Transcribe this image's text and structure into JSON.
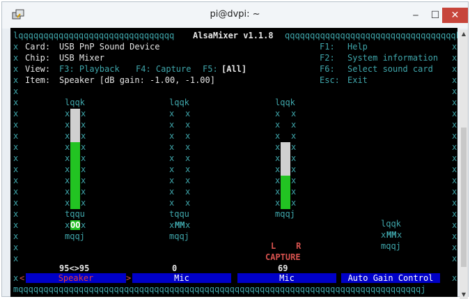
{
  "window": {
    "title": "pi@dvpi: ~",
    "min_glyph": "‒",
    "max_glyph": "☐",
    "close_glyph": "✕"
  },
  "header": {
    "top_border_left": "lqqqqqqqqqqqqqqqqqqqqqqqqqqqqqqq",
    "app_title": "AlsaMixer v1.1.8",
    "top_border_right": "qqqqqqqqqqqqqqqqqqqqqqqqqqqqqqqqqqk",
    "card_label": "Card:",
    "card_value": "USB PnP Sound Device",
    "chip_label": "Chip:",
    "chip_value": "USB Mixer",
    "view_label": "View:",
    "view_f3": "F3: Playback",
    "view_f4": "F4: Capture",
    "view_f5": "F5:",
    "view_f5_value": "[All]",
    "item_label": "Item:",
    "item_value": "Speaker [dB gain: -1.00, -1.00]",
    "f1": "F1:",
    "f1_value": "Help",
    "f2": "F2:",
    "f2_value": "System information",
    "f6": "F6:",
    "f6_value": "Select sound card",
    "esc": "Esc:",
    "esc_value": "Exit"
  },
  "border_char": "x",
  "channels": [
    {
      "name": "Speaker",
      "selected": true,
      "level_percent": 95,
      "value_label": "95<>95",
      "top_cap": "lqqk",
      "bottom_cap": "tqqu",
      "mute_box": "OO",
      "mute_prefix": "x",
      "mute_suffix": "x",
      "foot": "mqqj",
      "capture_labels": "",
      "capture_text": ""
    },
    {
      "name": "Mic",
      "selected": false,
      "level_percent": 0,
      "value_label": "0",
      "top_cap": "lqqk",
      "bottom_cap": "tqqu",
      "mute_box": "MM",
      "mute_prefix": "x",
      "mute_suffix": "x",
      "foot": "mqqj",
      "capture_labels": "",
      "capture_text": ""
    },
    {
      "name": "Mic",
      "selected": false,
      "level_percent": 69,
      "value_label": "69",
      "top_cap": "lqqk",
      "bottom_cap": "mqqj",
      "mute_box": "",
      "mute_prefix": "",
      "mute_suffix": "",
      "foot": "",
      "capture_labels": "L    R",
      "capture_text": "CAPTURE"
    },
    {
      "name": "Auto Gain Control",
      "selected": false,
      "level_percent": null,
      "value_label": "",
      "top_cap": "",
      "bottom_cap": "lqqk",
      "mute_box": "MM",
      "mute_prefix": "x",
      "mute_suffix": "x",
      "foot": "mqqj",
      "capture_labels": "",
      "capture_text": ""
    }
  ],
  "tab_prefix": "<",
  "tab_suffix": ">",
  "bottom_border": "mqqqqqqqqqqqqqqqqqqqqqqqqqqqqqqqqqqqqqqqqqqqqqqqqqqqqqqqqqqqqqqqqqqqqqqqqqqqqqqqqj",
  "colors": {
    "cyan": "#3fa6ab",
    "green": "#22c322",
    "bar_white": "#d0d0d0",
    "red": "#d9534f",
    "tab_blue": "#0000c8",
    "tab_red_text": "#e04040"
  }
}
